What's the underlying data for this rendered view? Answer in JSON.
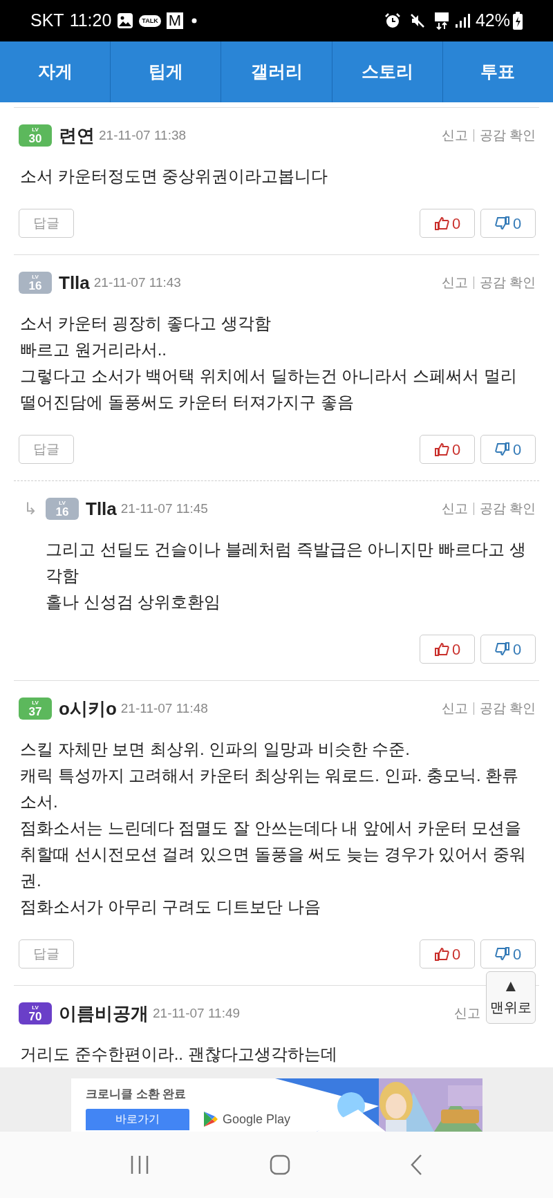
{
  "status_bar": {
    "carrier": "SKT",
    "time": "11:20",
    "talk_badge": "TALK",
    "mail_badge": "M",
    "battery": "42%"
  },
  "tabs": [
    {
      "label": "자게",
      "selected": false
    },
    {
      "label": "팁게",
      "selected": false
    },
    {
      "label": "갤러리",
      "selected": false
    },
    {
      "label": "스토리",
      "selected": false
    },
    {
      "label": "투표",
      "selected": false
    }
  ],
  "comments": [
    {
      "reply": false,
      "badge": {
        "top": "LV",
        "level": "30",
        "color": "#5cb85c"
      },
      "author": "련연",
      "date": "21-11-07 11:38",
      "report": "신고",
      "empathy": "공감 확인",
      "body": [
        "소서 카운터정도면 중상위권이라고봅니다"
      ],
      "reply_button": "답글",
      "likes": "0",
      "dislikes": "0"
    },
    {
      "reply": false,
      "badge": {
        "top": "LV",
        "level": "16",
        "color": "#a9b4c2"
      },
      "author": "Tlla",
      "date": "21-11-07 11:43",
      "report": "신고",
      "empathy": "공감 확인",
      "body": [
        "소서 카운터 굉장히 좋다고 생각함",
        "빠르고 원거리라서..",
        "그렇다고 소서가 백어택 위치에서 딜하는건 아니라서 스페써서 멀리 떨어진담에 돌풍써도 카운터 터져가지구 좋음"
      ],
      "reply_button": "답글",
      "likes": "0",
      "dislikes": "0"
    },
    {
      "reply": true,
      "arrow": "↳",
      "badge": {
        "top": "LV",
        "level": "16",
        "color": "#a9b4c2"
      },
      "author": "Tlla",
      "date": "21-11-07 11:45",
      "report": "신고",
      "empathy": "공감 확인",
      "body": [
        "그리고 선딜도 건슬이나 블레처럼 즉발급은 아니지만 빠르다고 생각함",
        "홀나 신성검 상위호환임"
      ],
      "likes": "0",
      "dislikes": "0"
    },
    {
      "reply": false,
      "badge": {
        "top": "LV",
        "level": "37",
        "color": "#5cb85c"
      },
      "author": "o시키o",
      "date": "21-11-07 11:48",
      "report": "신고",
      "empathy": "공감 확인",
      "body": [
        "스킬 자체만 보면 최상위. 인파의 일망과 비슷한 수준.",
        "캐릭 특성까지 고려해서 카운터 최상위는 워로드. 인파. 충모닉. 환류 소서.",
        "점화소서는 느린데다 점멸도 잘 안쓰는데다 내 앞에서 카운터 모션을 취할때 선시전모션 걸려 있으면 돌풍을 써도 늦는 경우가 있어서 중워권.",
        "점화소서가 아무리 구려도 디트보단 나음"
      ],
      "reply_button": "답글",
      "likes": "0",
      "dislikes": "0"
    },
    {
      "reply": false,
      "badge": {
        "top": "LV",
        "level": "70",
        "color": "#6a3fc8"
      },
      "author": "이름비공개",
      "date": "21-11-07 11:49",
      "report": "신고",
      "body": [
        "거리도 준수한편이라.. 괜찮다고생각하는데"
      ]
    }
  ],
  "top_button": {
    "arrow": "▲",
    "label": "맨위로"
  },
  "ad": {
    "headline": "크로니클 소환 완료",
    "cta": "바로가기",
    "store": "Google Play",
    "kind": "picture"
  }
}
